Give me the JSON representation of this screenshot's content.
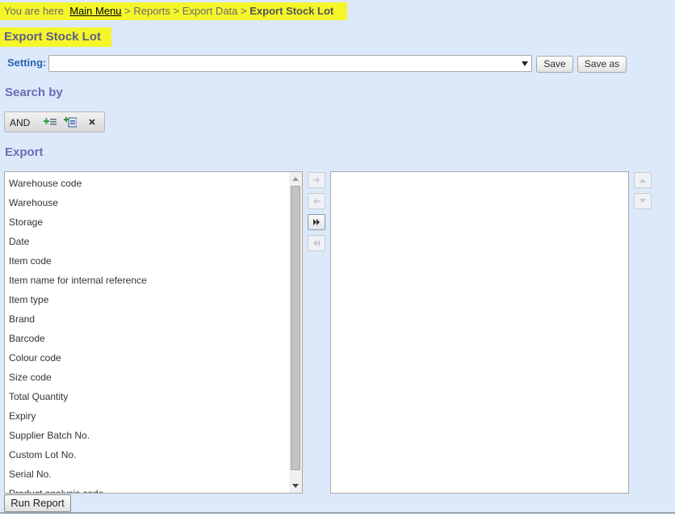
{
  "breadcrumb": {
    "prefix": "You are here",
    "main_menu": "Main Menu",
    "sep1": ">",
    "reports": "Reports",
    "sep2": ">",
    "export_data": "Export Data",
    "sep3": ">",
    "current": "Export Stock Lot"
  },
  "page_title": "Export Stock Lot",
  "setting": {
    "label": "Setting:",
    "value": "",
    "save_label": "Save",
    "save_as_label": "Save as"
  },
  "search_by": {
    "title": "Search by",
    "operator": "AND",
    "icons": [
      "add-condition-icon",
      "add-group-icon",
      "remove-icon"
    ]
  },
  "export": {
    "title": "Export",
    "available_fields": [
      "Warehouse code",
      "Warehouse",
      "Storage",
      "Date",
      "Item code",
      "Item name for internal reference",
      "Item type",
      "Brand",
      "Barcode",
      "Colour code",
      "Size code",
      "Total Quantity",
      "Expiry",
      "Supplier Batch No.",
      "Custom Lot No.",
      "Serial No.",
      "Product analysis code"
    ],
    "selected_fields": [],
    "move_buttons": [
      "move-right-icon",
      "move-left-icon",
      "move-all-right-icon",
      "move-all-left-icon"
    ],
    "order_buttons": [
      "move-up-icon",
      "move-down-icon"
    ]
  },
  "run_report_label": "Run Report",
  "colors": {
    "panel_bg": "#dce9fb",
    "highlight": "#f4f62a",
    "section_title": "#6a6fb5",
    "setting_label": "#2c62b0"
  }
}
